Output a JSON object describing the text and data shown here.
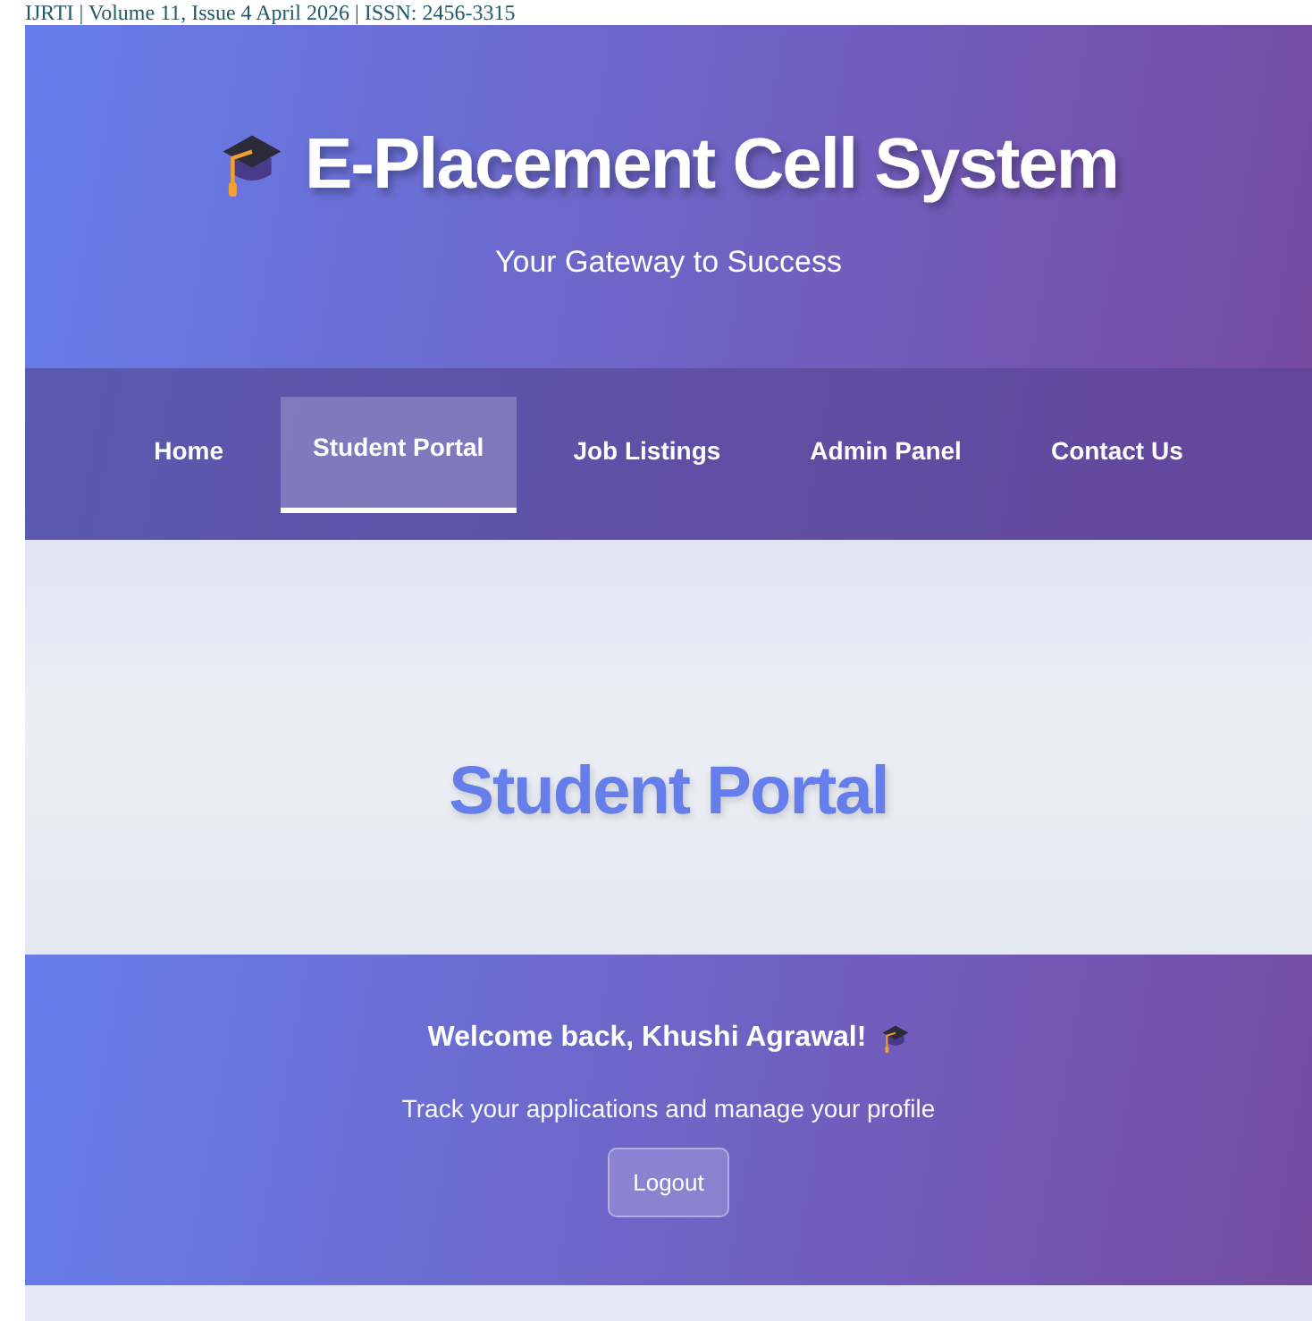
{
  "page_header": "IJRTI | Volume 11, Issue 4 April 2026 | ISSN: 2456-3315",
  "site": {
    "title": "E-Placement Cell System",
    "tagline": "Your Gateway to Success"
  },
  "nav": [
    {
      "label": "Home",
      "selected": false
    },
    {
      "label": "Student Portal",
      "selected": true
    },
    {
      "label": "Job Listings",
      "selected": false
    },
    {
      "label": "Admin Panel",
      "selected": false
    },
    {
      "label": "Contact Us",
      "selected": false
    }
  ],
  "section": {
    "title": "Student Portal"
  },
  "welcome": {
    "greeting": "Welcome back, Khushi Agrawal!",
    "subtitle": "Track your applications and manage your profile",
    "button": "Logout"
  }
}
